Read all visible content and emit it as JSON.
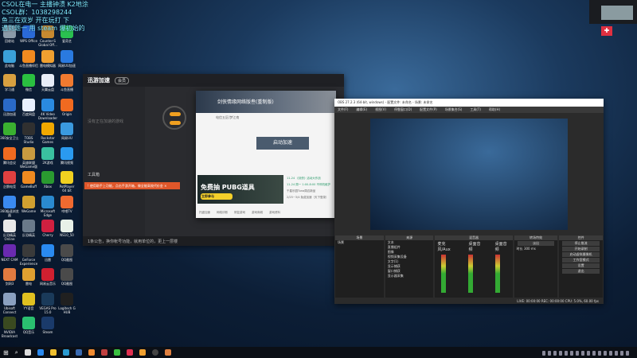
{
  "overlay_lines": [
    "CSOL在电一 主播钟渍 K2地涂",
    "CSOL群：1038298244",
    "鱼三在双岁 开在玩打 下",
    "遇到题一 用 steam 爆初始的"
  ],
  "desktop_icons": [
    {
      "label": "回收站",
      "color": "#8a9aa8"
    },
    {
      "label": "WPS Office",
      "color": "#2a6ad8"
    },
    {
      "label": "Counter-S Global Off...",
      "color": "#c88a30"
    },
    {
      "label": "爱奇艺",
      "color": "#2ac050"
    },
    {
      "label": "此电脑",
      "color": "#3aa0d8"
    },
    {
      "label": "斗鱼直播伴侣",
      "color": "#f08a20"
    },
    {
      "label": "雷电模拟器",
      "color": "#f0a030"
    },
    {
      "label": "网易UU加速",
      "color": "#2a7ae0"
    },
    {
      "label": "学习通",
      "color": "#d8a040"
    },
    {
      "label": "微信",
      "color": "#2ac040"
    },
    {
      "label": "天翼云盘",
      "color": "#e8eef8"
    },
    {
      "label": "斗鱼直播",
      "color": "#f07a30"
    },
    {
      "label": "迅游加速",
      "color": "#2a6ac8"
    },
    {
      "label": "百度网盘",
      "color": "#e8f0ff"
    },
    {
      "label": "4K Video Downloader",
      "color": "#2a8ae0"
    },
    {
      "label": "Origin",
      "color": "#f06a20"
    },
    {
      "label": "360安全卫士",
      "color": "#3ab030"
    },
    {
      "label": "TOBS Studio",
      "color": "#303030"
    },
    {
      "label": "Rockstar Games",
      "color": "#f0a800"
    },
    {
      "label": "网易UU",
      "color": "#3a9ae0"
    },
    {
      "label": "腾讯会议",
      "color": "#f06a20"
    },
    {
      "label": "英雄联盟WeGame版",
      "color": "#c89a40"
    },
    {
      "label": "2K游戏",
      "color": "#3ac0a0"
    },
    {
      "label": "腾讯视频",
      "color": "#2a9af0"
    },
    {
      "label": "企鹅电竞",
      "color": "#e04040"
    },
    {
      "label": "GameBuff",
      "color": "#f08a20"
    },
    {
      "label": "Xbox",
      "color": "#2a9a30"
    },
    {
      "label": "PotPlayer 64 bit",
      "color": "#f0d020"
    },
    {
      "label": "360极速浏览器",
      "color": "#3a8af0"
    },
    {
      "label": "WeGame",
      "color": "#d0a030"
    },
    {
      "label": "Microsoft Edge",
      "color": "#2a8ad0"
    },
    {
      "label": "哔哩TV",
      "color": "#f06a30"
    },
    {
      "label": "反恐精英 Online",
      "color": "#e8e8e8"
    },
    {
      "label": "反恐精英",
      "color": "#6a7a8a"
    },
    {
      "label": "Cherry",
      "color": "#d02040"
    },
    {
      "label": "NS10_50",
      "color": "#e8f0e8"
    },
    {
      "label": "NEXT CAM",
      "color": "#6a2ab0"
    },
    {
      "label": "GeForce Experience",
      "color": "#3a3a3a"
    },
    {
      "label": "迅雷",
      "color": "#2a8af0"
    },
    {
      "label": "QQ截图",
      "color": "#4a4a4a"
    },
    {
      "label": "剑网3",
      "color": "#e07a40"
    },
    {
      "label": "雷电",
      "color": "#e0a030"
    },
    {
      "label": "网易云音乐",
      "color": "#d02030"
    },
    {
      "label": "QQ截图",
      "color": "#4a4a4a"
    },
    {
      "label": "Ubisoft Connect",
      "color": "#8aa0c0"
    },
    {
      "label": "YY语音",
      "color": "#e0c020"
    },
    {
      "label": "VEGAS Pro 15.0",
      "color": "#1a3a5a"
    },
    {
      "label": "Logitech G HUB",
      "color": "#202020"
    },
    {
      "label": "NVIDIA Broadcast",
      "color": "#3a4a20"
    },
    {
      "label": "QQ音乐",
      "color": "#2ac070"
    },
    {
      "label": "Steam",
      "color": "#1a3a6a"
    }
  ],
  "accelerator": {
    "brand": "迅游加速",
    "badge": "会员",
    "banner": "! 使用助手上功能，点击手游开箱，做全能高效代价金 ×",
    "toolbox": "工具箱",
    "status": "1条公告，换你帐号功能，就用单位的，更上一层楼",
    "notice": "没有正在加速的游戏"
  },
  "game": {
    "title": "剑侠情缘网络版叁(重制版)",
    "server": "电信五区/梦江南",
    "start_button": "启动加速",
    "ad_text": "免费抽 PUBG道具",
    "ad_button": "立即参与",
    "news": [
      "11-24 《剑侠》活动大作战",
      "11-24 周一 1:00-8:00 不停机维护",
      "千星乐园Tuna周边新品",
      "2/25~3/4 免费加速（天下登录）"
    ],
    "tools": [
      "托盘加速",
      "网络诊断",
      "修复游戏",
      "游戏商城",
      "游戏资料"
    ]
  },
  "obs": {
    "title": "OBS 27.2.3 (64-bit, windows) - 配置文件: 未命名 - 场景: 未命名",
    "menu": [
      "文件(F)",
      "编辑(E)",
      "视图(V)",
      "停靠窗口(D)",
      "配置文件(P)",
      "场景集合(S)",
      "工具(T)",
      "帮助(H)"
    ],
    "docks": {
      "scenes": "场景",
      "sources": "来源",
      "mixer": "混音器",
      "transitions": "转场特效",
      "controls": "控件"
    },
    "scene_items": [
      "场景"
    ],
    "source_items": [
      "文本",
      "直播组件",
      "图像",
      "视频采集设备",
      "文字(1)",
      "显示捕获",
      "窗口捕获",
      "显示器采集"
    ],
    "mixer_channels": [
      "麦克风/Aux",
      "桌面音频",
      "桌面音频"
    ],
    "transition": "淡出",
    "duration_label": "时长",
    "duration": "300 ms",
    "controls": [
      "停止推流",
      "开始录制",
      "启动虚拟摄像机",
      "工作室模式",
      "设置",
      "退出"
    ],
    "status": "LIVE: 00:00:00  REC: 00:00:00  CPU: 5.0%, 60.00 fps"
  }
}
